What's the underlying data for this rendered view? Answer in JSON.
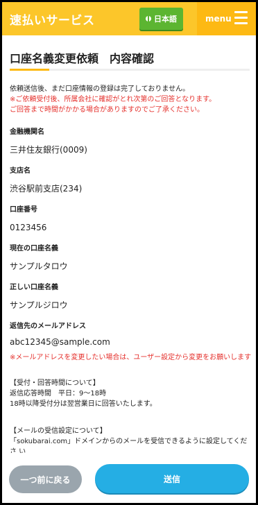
{
  "header": {
    "brand": "速払いサービス",
    "language_button": "日本語",
    "menu_label": "menu",
    "accent_color": "#fcc62a",
    "icons": [
      "globe-icon",
      "hamburger-icon"
    ]
  },
  "page": {
    "title": "口座名義変更依頼　内容確認"
  },
  "notice": {
    "line1": "依頼送信後、まだ口座情報の登録は完了しておりません。",
    "line2": "※ご依頼受付後、所属会社に確認がとれ次第のご回答となります。",
    "line3": "ご回答まで時間がかかる場合がありますのでご了承ください。"
  },
  "fields": {
    "bank_label": "金融機関名",
    "bank_value": "三井住友銀行(0009)",
    "branch_label": "支店名",
    "branch_value": "渋谷駅前支店(234)",
    "account_number_label": "口座番号",
    "account_number_value": "0123456",
    "current_name_label": "現在の口座名義",
    "current_name_value": "サンプルタロウ",
    "correct_name_label": "正しい口座名義",
    "correct_name_value": "サンプルジロウ",
    "reply_email_label": "返信先のメールアドレス",
    "reply_email_value": "abc12345@sample.com",
    "email_note": "※メールアドレスを変更したい場合は、ユーザー設定から変更をお願いします"
  },
  "hours": {
    "heading": "【受付・回答時間について】",
    "line1": "返信応答時間　平日：9〜18時",
    "line2": "18時以降受付分は翌営業日に回答いたします。"
  },
  "mail_settings": {
    "heading": "【メールの受信設定について】",
    "line1": "「sokubarai.com」ドメインからのメールを受信できるように設定してくださ い"
  },
  "footer": {
    "back_label": "一つ前に戻る",
    "send_label": "送信",
    "send_color": "#25aee4",
    "back_color": "#9aa5ad"
  }
}
